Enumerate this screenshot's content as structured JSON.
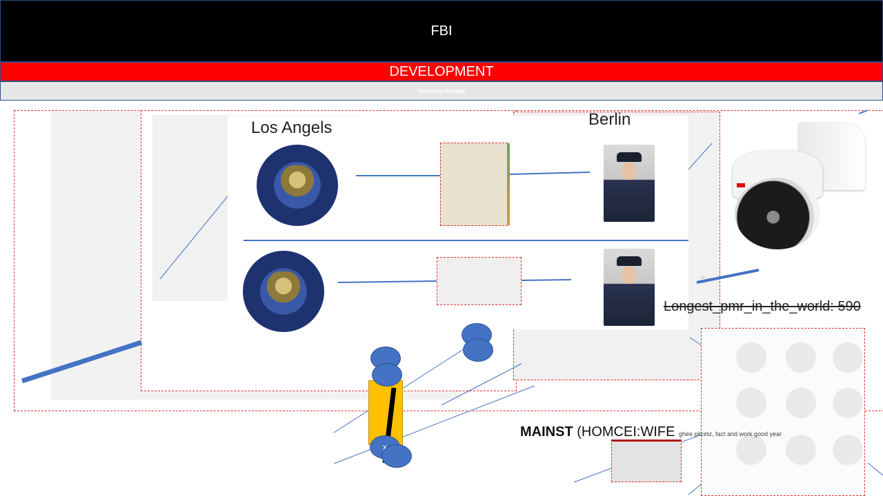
{
  "header": {
    "title": "FBI",
    "subtitle": "DEVELOPMENT",
    "tagline": "Sleeping Outside"
  },
  "map": {
    "left_city": "Los Angels",
    "right_city": "Berlin",
    "right_caption": "Longest_pmr_in_the_world: 590",
    "bottom_caption_bold": "MAINST",
    "bottom_caption_rest": " (HOMCEI:WIFE",
    "bottom_caption_small": "ghee pilcetz, fact and work good year",
    "marker_label": "x"
  },
  "colors": {
    "header_bg": "#000000",
    "accent_red": "#ff0000",
    "connector_blue": "#4472c4",
    "highlight_yellow": "#ffc000"
  },
  "icons": [
    "police-crest-icon",
    "security-camera-icon",
    "officer-photo",
    "portrait-grid"
  ]
}
